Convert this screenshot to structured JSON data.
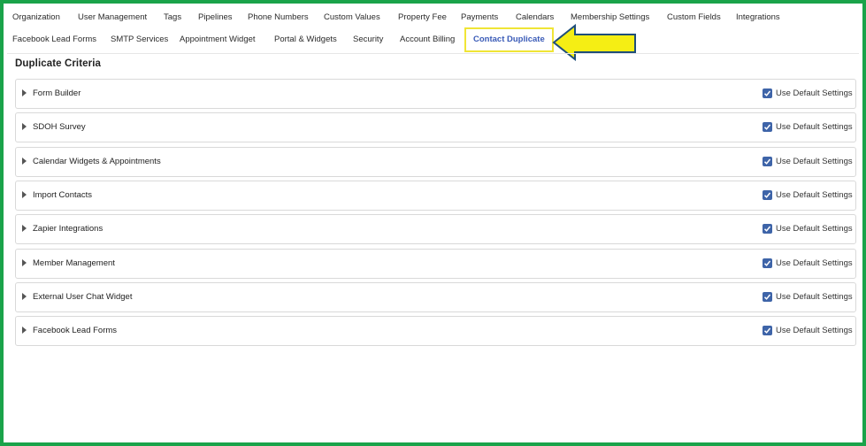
{
  "tabs_row1": [
    {
      "label": "Organization"
    },
    {
      "label": "User Management"
    },
    {
      "label": "Tags"
    },
    {
      "label": "Pipelines"
    },
    {
      "label": "Phone Numbers"
    },
    {
      "label": "Custom Values"
    },
    {
      "label": "Property Fee"
    },
    {
      "label": "Payments"
    },
    {
      "label": "Calendars"
    },
    {
      "label": "Membership Settings"
    },
    {
      "label": "Custom Fields"
    },
    {
      "label": "Integrations"
    }
  ],
  "tabs_row2": [
    {
      "label": "Facebook Lead Forms"
    },
    {
      "label": "SMTP Services"
    },
    {
      "label": "Appointment Widget"
    },
    {
      "label": "Portal & Widgets"
    },
    {
      "label": "Security"
    },
    {
      "label": "Account Billing"
    },
    {
      "label": "Contact Duplicate"
    }
  ],
  "active_tab": "Contact Duplicate",
  "section_title": "Duplicate Criteria",
  "checkbox_label": "Use Default Settings",
  "criteria": [
    {
      "label": "Form Builder",
      "checked": true
    },
    {
      "label": "SDOH Survey",
      "checked": true
    },
    {
      "label": "Calendar Widgets & Appointments",
      "checked": true
    },
    {
      "label": "Import Contacts",
      "checked": true
    },
    {
      "label": "Zapier Integrations",
      "checked": true
    },
    {
      "label": "Member Management",
      "checked": true
    },
    {
      "label": "External User Chat Widget",
      "checked": true
    },
    {
      "label": "Facebook Lead Forms",
      "checked": true
    }
  ],
  "colors": {
    "frame_border": "#1aa34a",
    "active_tab_text": "#3a5bb7",
    "active_tab_highlight": "#f0e536",
    "checkbox": "#3e64a8",
    "annotation_arrow_fill": "#f5ee14",
    "annotation_arrow_stroke": "#1f4e7a"
  },
  "icons": {
    "annotation": "arrow-left-icon",
    "row_toggle": "caret-right-icon",
    "checkbox": "checkmark-icon"
  }
}
